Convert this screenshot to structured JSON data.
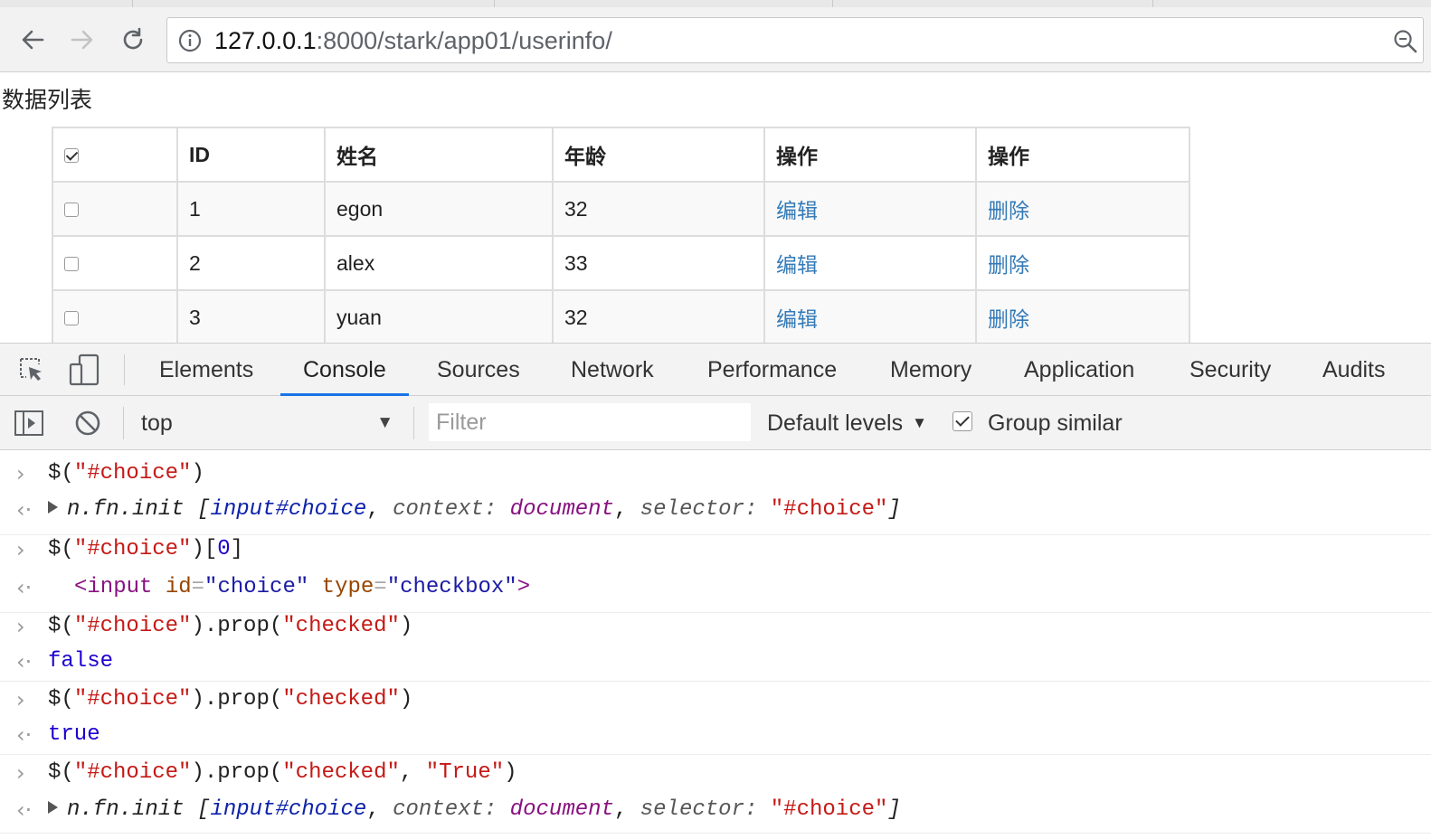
{
  "browser": {
    "url_host": "127.0.0.1",
    "url_rest": ":8000/stark/app01/userinfo/"
  },
  "page": {
    "title": "数据列表",
    "table": {
      "headers": [
        "ID",
        "姓名",
        "年龄",
        "操作",
        "操作"
      ],
      "rows": [
        {
          "id": "1",
          "name": "egon",
          "age": "32",
          "edit": "编辑",
          "delete": "删除"
        },
        {
          "id": "2",
          "name": "alex",
          "age": "33",
          "edit": "编辑",
          "delete": "删除"
        },
        {
          "id": "3",
          "name": "yuan",
          "age": "32",
          "edit": "编辑",
          "delete": "删除"
        }
      ]
    }
  },
  "devtools": {
    "tabs": [
      "Elements",
      "Console",
      "Sources",
      "Network",
      "Performance",
      "Memory",
      "Application",
      "Security",
      "Audits"
    ],
    "active_tab": "Console",
    "context": "top",
    "filter_placeholder": "Filter",
    "levels": "Default levels",
    "group_similar": "Group similar"
  },
  "console": {
    "dollar": "$(",
    "paren_close": ")",
    "selector": "\"#choice\"",
    "index_open": "[",
    "index": "0",
    "index_close": "]",
    "prop_call": ".prop(",
    "checked": "\"checked\"",
    "comma": ", ",
    "true_str": "\"True\"",
    "fn_init": "n.fn.init ",
    "bracket_open": "[",
    "input_choice": "input#choice",
    "context_key": "context",
    "colon": ": ",
    "document": "document",
    "selector_key": "selector",
    "bracket_close": "]",
    "tag_open": "<input",
    "attr_id": "id",
    "eq": "=",
    "val_id": "\"choice\"",
    "attr_type": "type",
    "val_type": "\"checkbox\"",
    "tag_close": ">",
    "false": "false",
    "true": "true"
  },
  "colors": {
    "link": "#337ab7",
    "active_tab_underline": "#1a73e8",
    "string": "#c41a16",
    "keyword": "#1c00cf"
  }
}
